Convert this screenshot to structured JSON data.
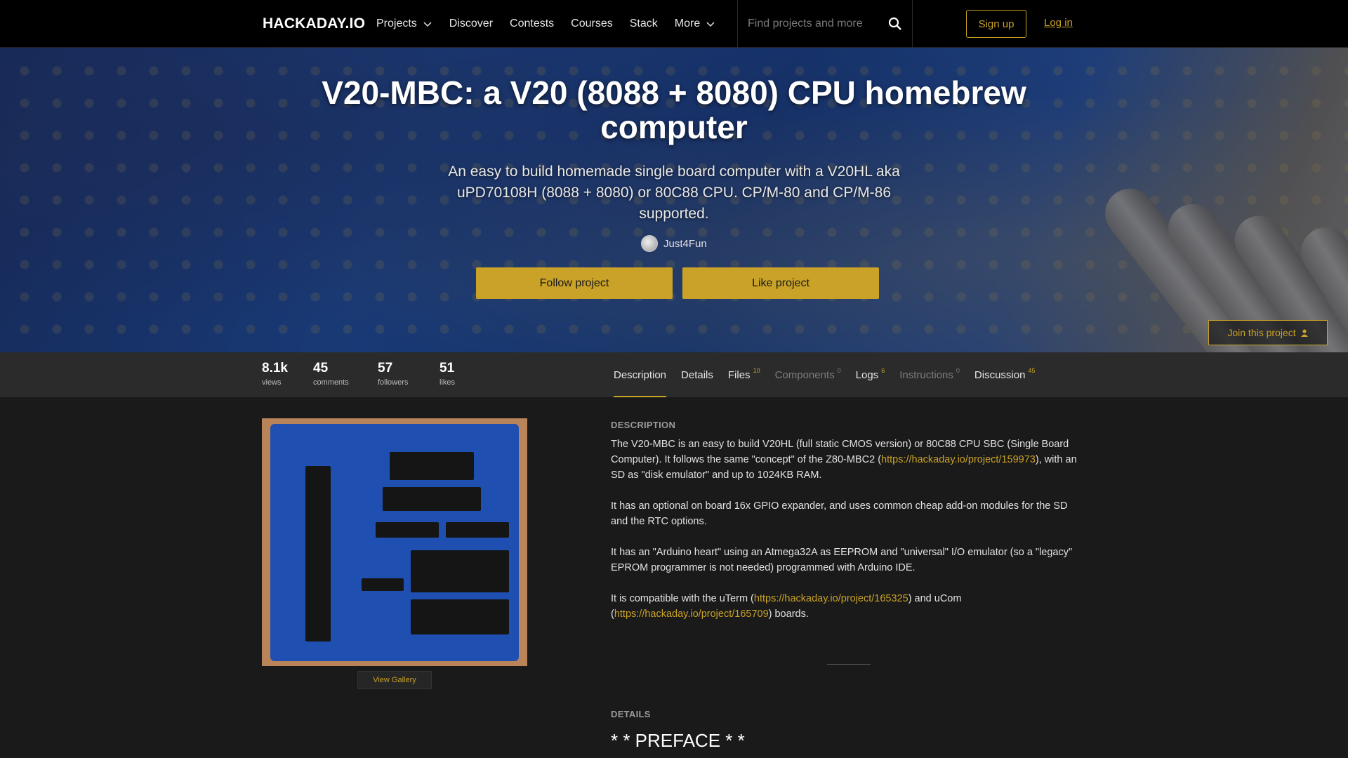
{
  "nav": {
    "logo": "HACKADAY.IO",
    "links": [
      "Projects",
      "Discover",
      "Contests",
      "Courses",
      "Stack",
      "More"
    ],
    "search_placeholder": "Find projects and more",
    "signup": "Sign up",
    "login": "Log in"
  },
  "hero": {
    "title": "V20-MBC: a V20 (8088 + 8080) CPU homebrew computer",
    "subtitle": "An easy to build homemade single board computer with a V20HL aka uPD70108H (8088 + 8080) or 80C88 CPU. CP/M-80 and CP/M-86 supported.",
    "author": "Just4Fun",
    "follow_label": "Follow project",
    "like_label": "Like project",
    "join_label": "Join this project"
  },
  "stats": [
    {
      "value": "8.1k",
      "label": "views"
    },
    {
      "value": "45",
      "label": "comments"
    },
    {
      "value": "57",
      "label": "followers"
    },
    {
      "value": "51",
      "label": "likes"
    }
  ],
  "tabs": [
    {
      "label": "Description",
      "count": ""
    },
    {
      "label": "Details",
      "count": ""
    },
    {
      "label": "Files",
      "count": "10"
    },
    {
      "label": "Components",
      "count": "0"
    },
    {
      "label": "Logs",
      "count": "6"
    },
    {
      "label": "Instructions",
      "count": "0"
    },
    {
      "label": "Discussion",
      "count": "45"
    }
  ],
  "gallery": {
    "view_label": "View Gallery"
  },
  "description": {
    "heading": "DESCRIPTION",
    "p1_a": "The V20-MBC is an easy to build V20HL (full static CMOS version) or 80C88 CPU SBC (Single Board Computer). It follows the same \"concept\" of the Z80-MBC2 (",
    "p1_link": "https://hackaday.io/project/159973",
    "p1_b": "), with an SD as \"disk emulator\" and up to 1024KB RAM.",
    "p2": "It has an optional on board 16x GPIO expander, and uses common cheap add-on modules for the SD and the RTC options.",
    "p3": "It has an \"Arduino heart\" using an Atmega32A as EEPROM and \"universal\" I/O emulator (so a \"legacy\" EPROM programmer is not needed) programmed with Arduino IDE.",
    "p4_a": "It is compatible with the uTerm (",
    "p4_link1": "https://hackaday.io/project/165325",
    "p4_b": ") and uCom (",
    "p4_link2": "https://hackaday.io/project/165709",
    "p4_c": ") boards."
  },
  "details": {
    "heading": "DETAILS",
    "preface": "* * PREFACE * *"
  },
  "colors": {
    "accent": "#c9a227",
    "nav_bg": "#000000",
    "page_bg": "#1a1a1a",
    "bar_bg": "#2b2b2b"
  }
}
